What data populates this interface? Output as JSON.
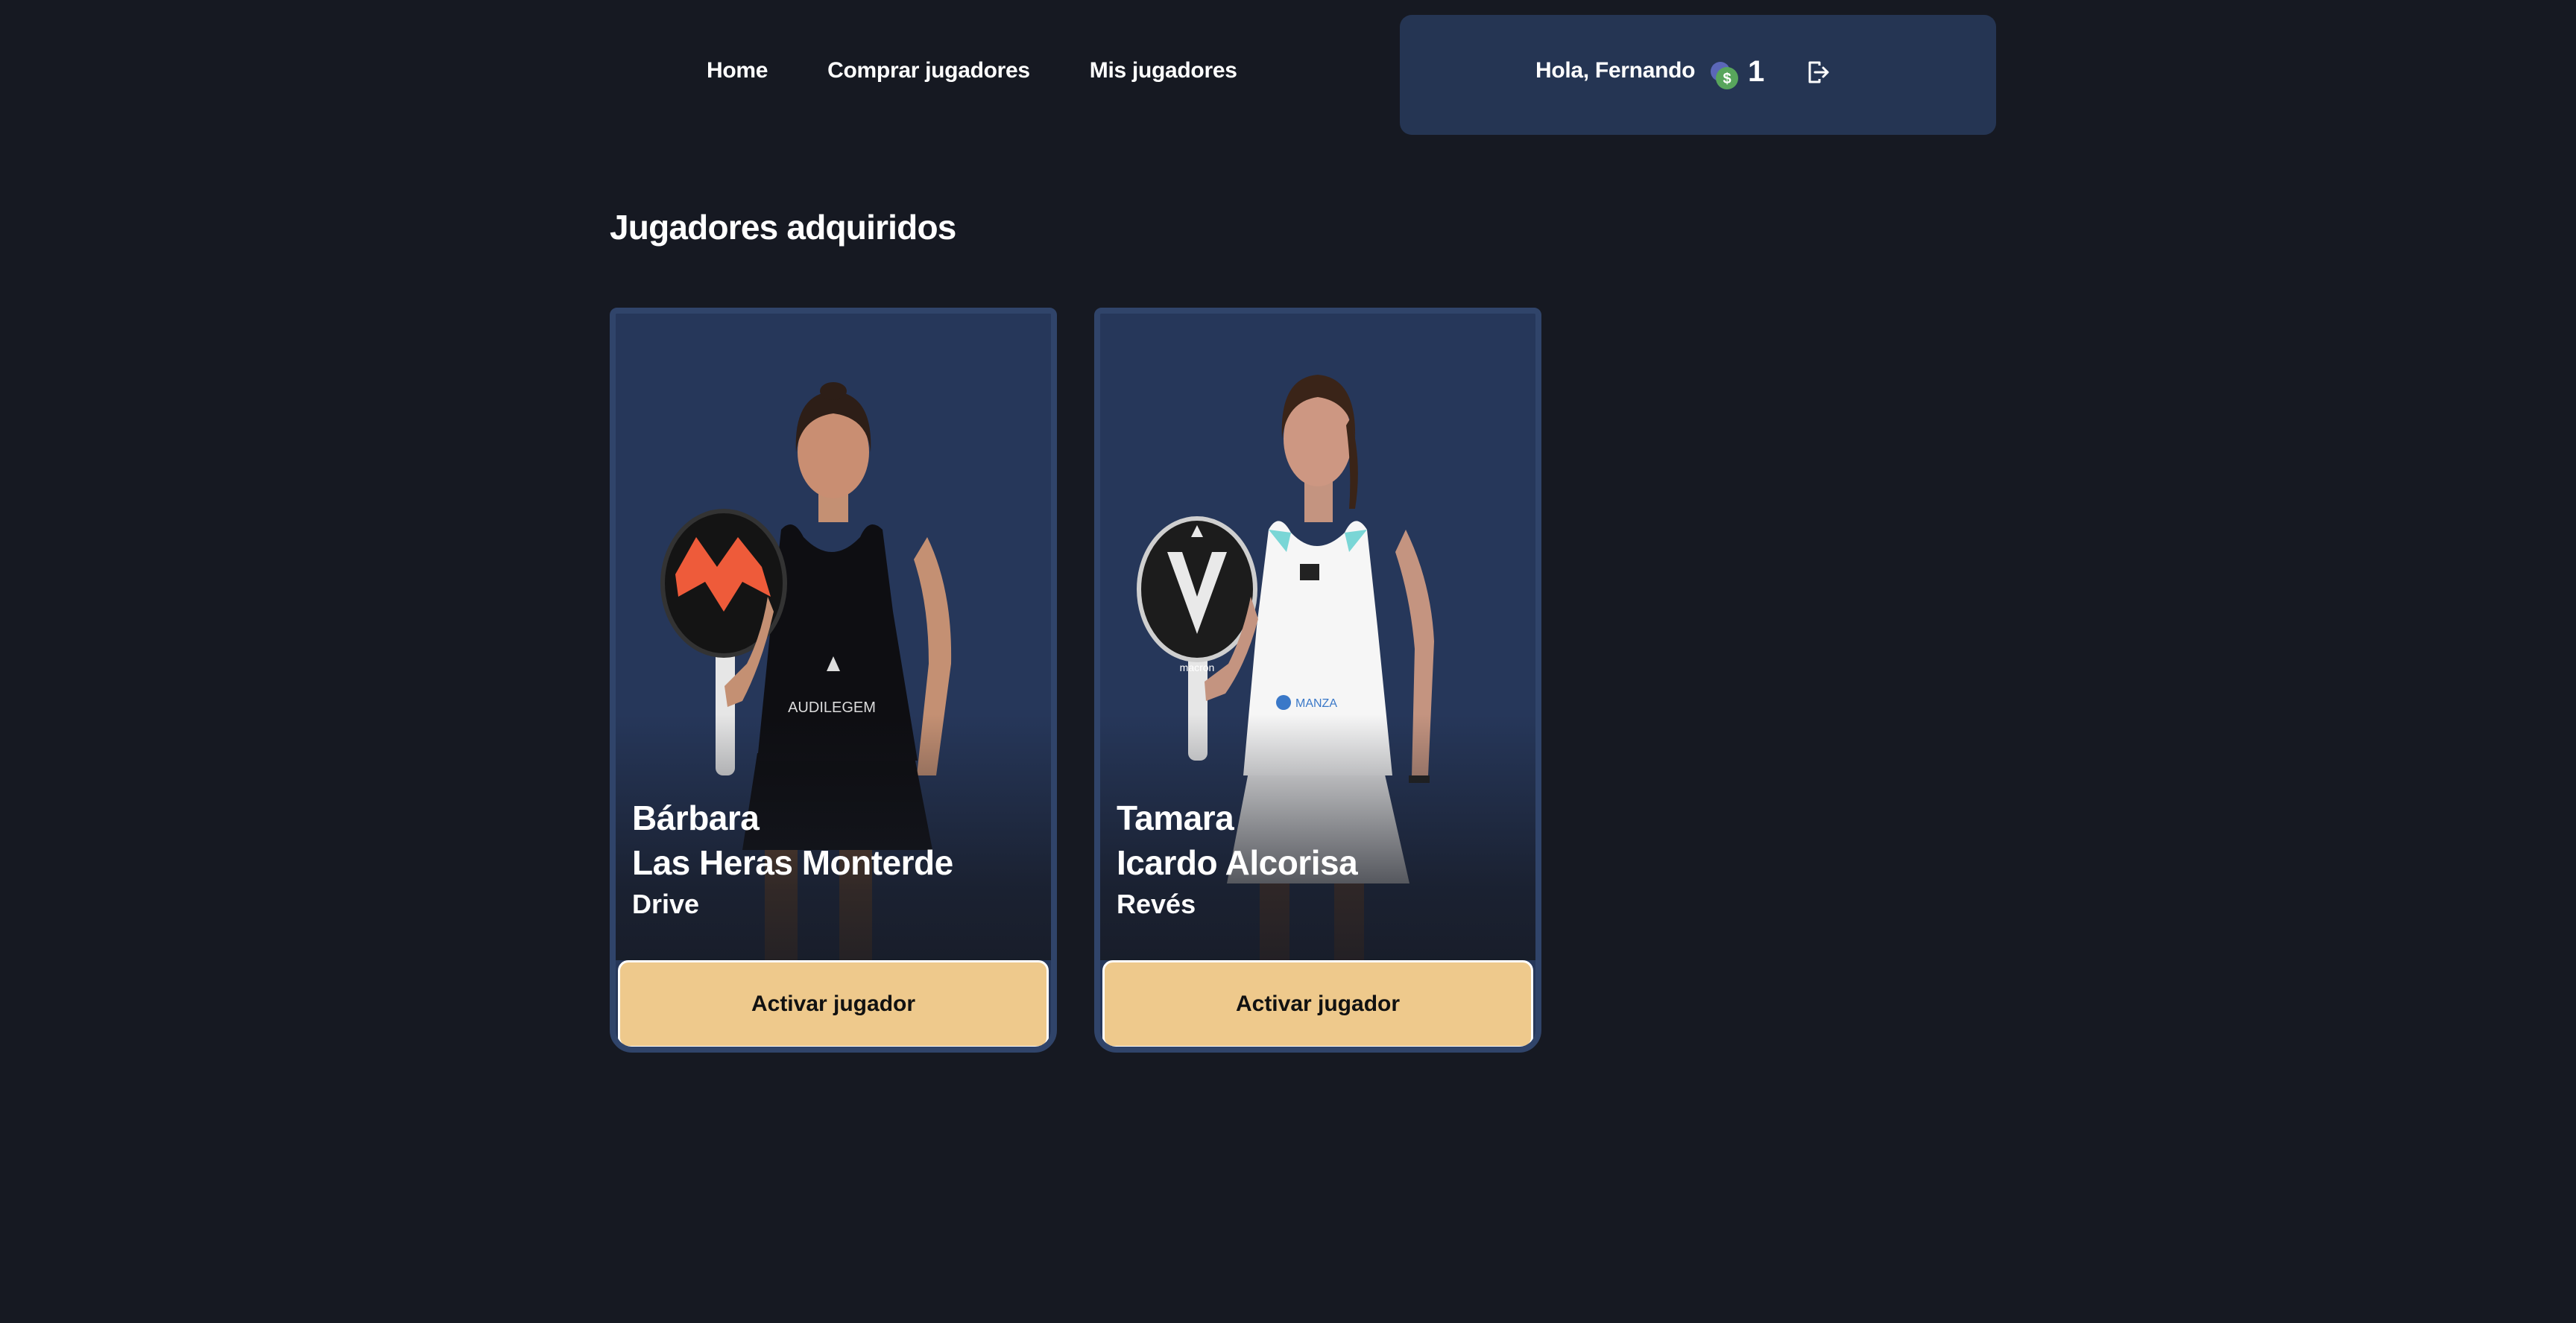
{
  "nav": {
    "home": "Home",
    "buy_players": "Comprar jugadores",
    "my_players": "Mis jugadores"
  },
  "user": {
    "greeting": "Hola, Fernando",
    "coins": "1",
    "coin_icon": "coin-dollar-icon",
    "logout_icon": "logout-icon"
  },
  "section": {
    "title": "Jugadores adquiridos"
  },
  "players": [
    {
      "first_name": "Bárbara",
      "last_name": "Las Heras Monterde",
      "position": "Drive",
      "button_label": "Activar jugador",
      "photo_logo": "AUDILEGEM"
    },
    {
      "first_name": "Tamara",
      "last_name": "Icardo Alcorisa",
      "position": "Revés",
      "button_label": "Activar jugador",
      "photo_logo": "macron"
    }
  ],
  "colors": {
    "background": "#161922",
    "panel": "#253553",
    "card": "#26375a",
    "card_border": "#30446a",
    "button": "#eec98c"
  }
}
